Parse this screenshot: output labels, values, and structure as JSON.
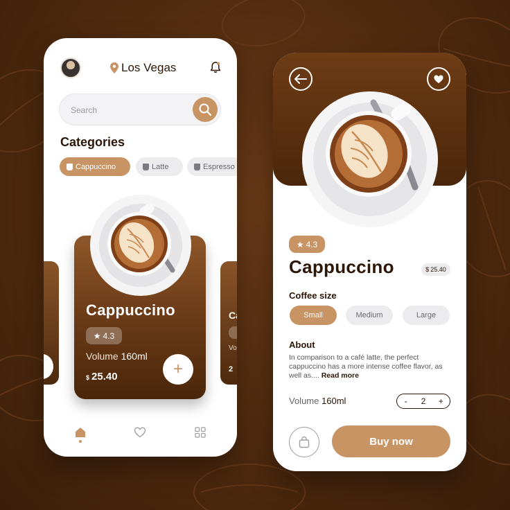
{
  "colors": {
    "accent": "#c89464",
    "dark_brown": "#4a2609",
    "background": "#4f2a0f"
  },
  "home": {
    "location": "Los Vegas",
    "search": {
      "placeholder": "Search"
    },
    "categories_title": "Categories",
    "categories": [
      {
        "label": "Cappuccino",
        "icon": "cup-icon",
        "active": true
      },
      {
        "label": "Latte",
        "icon": "glass-icon",
        "active": false
      },
      {
        "label": "Espresso",
        "icon": "machine-icon",
        "active": false
      }
    ],
    "featured": {
      "name": "Cappuccino",
      "rating": "4.3",
      "volume_label": "Volume",
      "volume_value": "160ml",
      "currency": "$",
      "price": "25.40"
    },
    "next_card": {
      "name_partial": "Ca",
      "volume_partial": "Vo",
      "price_partial": "2"
    },
    "nav": [
      "home-icon",
      "heart-icon",
      "grid-icon"
    ]
  },
  "detail": {
    "rating": "4.3",
    "name": "Cappuccino",
    "currency": "$",
    "price": "25.40",
    "size_title": "Coffee size",
    "sizes": [
      {
        "label": "Small",
        "active": true
      },
      {
        "label": "Medium",
        "active": false
      },
      {
        "label": "Large",
        "active": false
      }
    ],
    "about_title": "About",
    "about_text": "In comparison to a café latte, the perfect cappuccino has a more intense coffee flavor, as well as....",
    "read_more": "Read more",
    "volume_label": "Volume",
    "volume_value": "160ml",
    "quantity": "2",
    "minus": "-",
    "plus": "+",
    "buy_label": "Buy now"
  }
}
